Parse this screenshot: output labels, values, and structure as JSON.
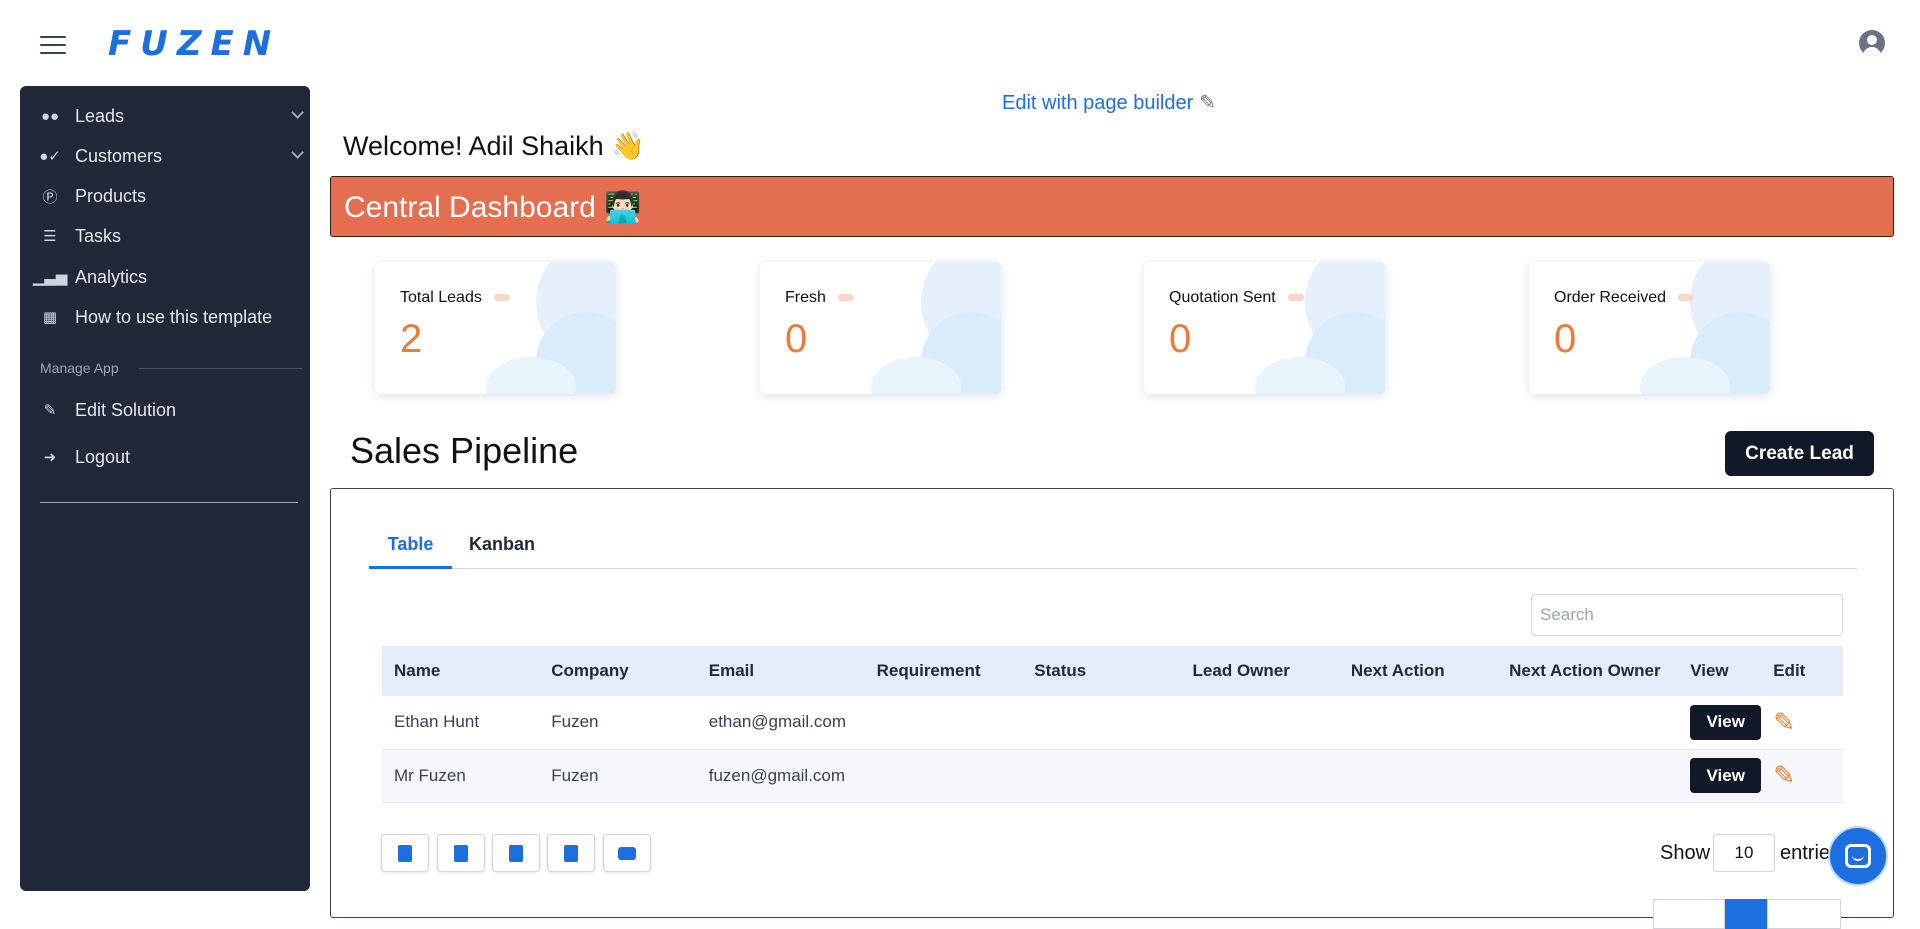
{
  "header": {
    "logo": "FUZEN"
  },
  "sidebar": {
    "items": [
      {
        "label": "Leads",
        "icon": "users-icon"
      },
      {
        "label": "Customers",
        "icon": "user-check-icon"
      },
      {
        "label": "Products",
        "icon": "product-badge-icon"
      },
      {
        "label": "Tasks",
        "icon": "tasks-list-icon"
      },
      {
        "label": "Analytics",
        "icon": "bar-chart-icon"
      },
      {
        "label": "How to use this template",
        "icon": "book-icon"
      }
    ],
    "section_label": "Manage App",
    "manage_items": [
      {
        "label": "Edit Solution",
        "icon": "pencil-icon"
      },
      {
        "label": "Logout",
        "icon": "logout-icon"
      }
    ]
  },
  "main": {
    "edit_builder": "Edit with page builder",
    "welcome": "Welcome! Adil Shaikh 👋",
    "banner_title": "Central Dashboard 👨🏻‍💻",
    "banner_color": "#e46e50",
    "stats": [
      {
        "label": "Total Leads",
        "value": "2"
      },
      {
        "label": "Fresh",
        "value": "0"
      },
      {
        "label": "Quotation Sent",
        "value": "0"
      },
      {
        "label": "Order Received",
        "value": "0"
      }
    ],
    "pipeline_title": "Sales Pipeline",
    "create_lead": "Create Lead",
    "tabs": [
      {
        "label": "Table",
        "active": true
      },
      {
        "label": "Kanban",
        "active": false
      }
    ],
    "search_placeholder": "Search",
    "table": {
      "columns": [
        "Name",
        "Company",
        "Email",
        "Requirement",
        "Status",
        "Lead Owner",
        "Next Action",
        "Next Action Owner",
        "View",
        "Edit"
      ],
      "rows": [
        {
          "name": "Ethan Hunt",
          "company": "Fuzen",
          "email": "ethan@gmail.com",
          "requirement": "",
          "status": "",
          "lead_owner": "",
          "next_action": "",
          "next_action_owner": "",
          "view": "View"
        },
        {
          "name": "Mr Fuzen",
          "company": "Fuzen",
          "email": "fuzen@gmail.com",
          "requirement": "",
          "status": "",
          "lead_owner": "",
          "next_action": "",
          "next_action_owner": "",
          "view": "View"
        }
      ]
    },
    "export_buttons": [
      "copy-icon",
      "csv-icon",
      "excel-icon",
      "pdf-icon",
      "print-icon"
    ],
    "show_label": "Show",
    "entries_value": "10",
    "entries_label": "entries"
  },
  "colors": {
    "accent": "#1d6fe0",
    "sidebar_bg": "#1f2937",
    "stat_value": "#ef7a38",
    "dark_button": "#111827"
  }
}
